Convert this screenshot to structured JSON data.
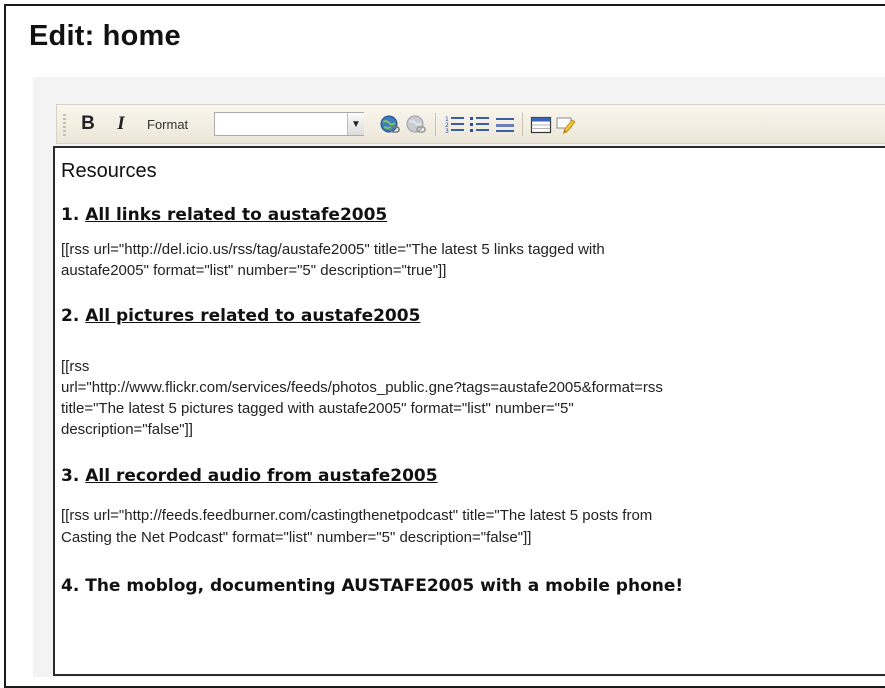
{
  "page": {
    "title": "Edit: home"
  },
  "toolbar": {
    "bold_label": "B",
    "italic_label": "I",
    "format_label": "Format",
    "format_value": "",
    "icons": [
      "insert-link-icon",
      "remove-link-icon",
      "ordered-list-icon",
      "unordered-list-icon",
      "horizontal-rule-icon",
      "table-icon",
      "clean-html-icon"
    ]
  },
  "editor": {
    "heading": "Resources",
    "sections": [
      {
        "number": "1.",
        "title": "All links related to austafe2005",
        "lines": [
          "[[rss url=\"http://del.icio.us/rss/tag/austafe2005\" title=\"The latest 5 links tagged with",
          "austafe2005\" format=\"list\" number=\"5\" description=\"true\"]]"
        ]
      },
      {
        "number": "2.",
        "title": "All pictures related to austafe2005",
        "lines": [
          "[[rss",
          "url=\"http://www.flickr.com/services/feeds/photos_public.gne?tags=austafe2005&format=rss",
          "title=\"The latest 5 pictures tagged with austafe2005\" format=\"list\" number=\"5\"",
          "description=\"false\"]]"
        ]
      },
      {
        "number": "3.",
        "title": "All recorded audio from austafe2005",
        "lines": [
          "[[rss url=\"http://feeds.feedburner.com/castingthenetpodcast\" title=\"The latest 5 posts from",
          "Casting the Net Podcast\" format=\"list\" number=\"5\" description=\"false\"]]"
        ]
      },
      {
        "number": "4.",
        "title": "The moblog, documenting AUSTAFE2005 with a mobile phone!"
      }
    ]
  }
}
